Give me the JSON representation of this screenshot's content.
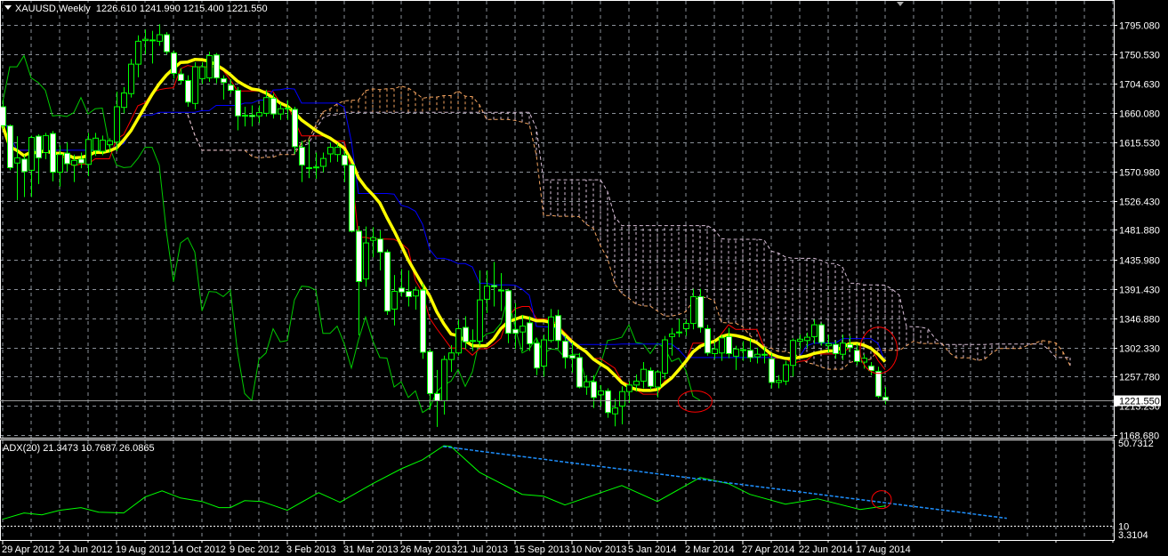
{
  "header": {
    "symbol_timeframe": "XAUUSD,Weekly",
    "open": "1226.610",
    "high": "1241.990",
    "low": "1215.400",
    "close": "1221.550"
  },
  "indicator_header": {
    "name": "ADX(20)",
    "values": "21.3473 10.7687 26.0865"
  },
  "colors": {
    "background": "#000000",
    "grid": "#8a9098",
    "bull_body": "#000000",
    "bear_body": "#ffffff",
    "candle_outline": "#00ff00",
    "ma": "#ffff00",
    "tenkan": "#ff0000",
    "kijun": "#0000ff",
    "chikou": "#00cc00",
    "senkou_a": "#f4a460",
    "senkou_b": "#d8bfd8",
    "adx": "#00ff00",
    "trendline": "#1e90ff",
    "annotation": "#ff0000"
  },
  "chart_data": [
    {
      "type": "candlestick",
      "title": "XAUUSD,Weekly",
      "ylim": [
        1164.6,
        1833.0
      ],
      "price_axis_labels": [
        "1795.080",
        "1750.530",
        "1704.630",
        "1660.080",
        "1615.530",
        "1570.980",
        "1526.430",
        "1481.880",
        "1435.980",
        "1391.430",
        "1346.880",
        "1302.330",
        "1257.780",
        "1213.230",
        "1168.680"
      ],
      "current_price": "1221.550",
      "date_labels": [
        "29 Apr 2012",
        "24 Jun 2012",
        "19 Aug 2012",
        "14 Oct 2012",
        "9 Dec 2012",
        "3 Feb 2013",
        "31 Mar 2013",
        "26 May 2013",
        "21 Jul 2013",
        "15 Sep 2013",
        "10 Nov 2013",
        "5 Jan 2014",
        "2 Mar 2014",
        "27 Apr 2014",
        "22 Jun 2014",
        "17 Aug 2014"
      ],
      "weeks_per_date_label": 8,
      "ohlc": [
        [
          1670,
          1680,
          1636,
          1641
        ],
        [
          1641,
          1643,
          1573,
          1577
        ],
        [
          1584,
          1625,
          1527,
          1592
        ],
        [
          1590,
          1596,
          1532,
          1571
        ],
        [
          1573,
          1626,
          1532,
          1623
        ],
        [
          1625,
          1628,
          1552,
          1592
        ],
        [
          1600,
          1630,
          1590,
          1626
        ],
        [
          1629,
          1633,
          1556,
          1570
        ],
        [
          1570,
          1611,
          1548,
          1597
        ],
        [
          1599,
          1616,
          1571,
          1583
        ],
        [
          1581,
          1597,
          1555,
          1588
        ],
        [
          1590,
          1600,
          1576,
          1584
        ],
        [
          1582,
          1630,
          1564,
          1620
        ],
        [
          1603,
          1630,
          1595,
          1622
        ],
        [
          1602,
          1626,
          1596,
          1619
        ],
        [
          1612,
          1622,
          1600,
          1618
        ],
        [
          1616,
          1693,
          1602,
          1670
        ],
        [
          1669,
          1700,
          1660,
          1691
        ],
        [
          1690,
          1743,
          1684,
          1735
        ],
        [
          1735,
          1779,
          1715,
          1770
        ],
        [
          1771,
          1788,
          1750,
          1773
        ],
        [
          1772,
          1786,
          1736,
          1772
        ],
        [
          1770,
          1796,
          1763,
          1780
        ],
        [
          1780,
          1784,
          1750,
          1754
        ],
        [
          1752,
          1756,
          1713,
          1721
        ],
        [
          1720,
          1729,
          1704,
          1710
        ],
        [
          1710,
          1718,
          1670,
          1677
        ],
        [
          1675,
          1738,
          1666,
          1731
        ],
        [
          1713,
          1738,
          1705,
          1731
        ],
        [
          1714,
          1754,
          1708,
          1748
        ],
        [
          1749,
          1752,
          1706,
          1714
        ],
        [
          1713,
          1718,
          1681,
          1707
        ],
        [
          1703,
          1712,
          1690,
          1695
        ],
        [
          1695,
          1700,
          1634,
          1656
        ],
        [
          1656,
          1670,
          1640,
          1657
        ],
        [
          1657,
          1672,
          1640,
          1655
        ],
        [
          1656,
          1672,
          1645,
          1661
        ],
        [
          1660,
          1696,
          1655,
          1684
        ],
        [
          1683,
          1690,
          1652,
          1659
        ],
        [
          1659,
          1675,
          1650,
          1667
        ],
        [
          1668,
          1680,
          1650,
          1668
        ],
        [
          1666,
          1670,
          1598,
          1609
        ],
        [
          1608,
          1618,
          1555,
          1581
        ],
        [
          1577,
          1620,
          1561,
          1577
        ],
        [
          1577,
          1600,
          1560,
          1578
        ],
        [
          1579,
          1600,
          1570,
          1591
        ],
        [
          1598,
          1615,
          1585,
          1608
        ],
        [
          1597,
          1614,
          1586,
          1608
        ],
        [
          1596,
          1602,
          1555,
          1581
        ],
        [
          1581,
          1583,
          1478,
          1480
        ],
        [
          1480,
          1488,
          1321,
          1403
        ],
        [
          1407,
          1487,
          1395,
          1462
        ],
        [
          1466,
          1486,
          1440,
          1470
        ],
        [
          1468,
          1481,
          1420,
          1448
        ],
        [
          1448,
          1452,
          1352,
          1358
        ],
        [
          1361,
          1413,
          1336,
          1388
        ],
        [
          1393,
          1422,
          1380,
          1387
        ],
        [
          1388,
          1420,
          1365,
          1380
        ],
        [
          1381,
          1395,
          1360,
          1390
        ],
        [
          1390,
          1400,
          1285,
          1295
        ],
        [
          1296,
          1300,
          1208,
          1232
        ],
        [
          1232,
          1268,
          1181,
          1221
        ],
        [
          1221,
          1290,
          1200,
          1284
        ],
        [
          1284,
          1306,
          1265,
          1294
        ],
        [
          1294,
          1345,
          1290,
          1331
        ],
        [
          1333,
          1350,
          1300,
          1311
        ],
        [
          1313,
          1330,
          1297,
          1313
        ],
        [
          1312,
          1420,
          1305,
          1375
        ],
        [
          1376,
          1420,
          1355,
          1396
        ],
        [
          1397,
          1433,
          1365,
          1395
        ],
        [
          1390,
          1416,
          1358,
          1390
        ],
        [
          1389,
          1392,
          1309,
          1324
        ],
        [
          1330,
          1370,
          1300,
          1324
        ],
        [
          1326,
          1352,
          1297,
          1335
        ],
        [
          1340,
          1350,
          1297,
          1308
        ],
        [
          1309,
          1316,
          1260,
          1271
        ],
        [
          1274,
          1322,
          1258,
          1314
        ],
        [
          1313,
          1361,
          1310,
          1349
        ],
        [
          1351,
          1360,
          1300,
          1313
        ],
        [
          1312,
          1320,
          1270,
          1287
        ],
        [
          1290,
          1310,
          1264,
          1286
        ],
        [
          1287,
          1294,
          1240,
          1242
        ],
        [
          1242,
          1260,
          1230,
          1250
        ],
        [
          1250,
          1260,
          1210,
          1226
        ],
        [
          1230,
          1245,
          1212,
          1236
        ],
        [
          1236,
          1240,
          1195,
          1203
        ],
        [
          1201,
          1224,
          1182,
          1210
        ],
        [
          1213,
          1243,
          1185,
          1235
        ],
        [
          1235,
          1251,
          1218,
          1245
        ],
        [
          1245,
          1261,
          1235,
          1251
        ],
        [
          1251,
          1280,
          1240,
          1269
        ],
        [
          1267,
          1272,
          1238,
          1243
        ],
        [
          1242,
          1268,
          1226,
          1265
        ],
        [
          1263,
          1320,
          1254,
          1314
        ],
        [
          1319,
          1332,
          1290,
          1323
        ],
        [
          1326,
          1346,
          1318,
          1326
        ],
        [
          1331,
          1345,
          1320,
          1339
        ],
        [
          1339,
          1392,
          1330,
          1380
        ],
        [
          1380,
          1392,
          1325,
          1333
        ],
        [
          1331,
          1337,
          1290,
          1294
        ],
        [
          1293,
          1312,
          1285,
          1300
        ],
        [
          1294,
          1322,
          1282,
          1317
        ],
        [
          1319,
          1332,
          1286,
          1293
        ],
        [
          1289,
          1305,
          1268,
          1300
        ],
        [
          1299,
          1312,
          1282,
          1299
        ],
        [
          1298,
          1315,
          1280,
          1287
        ],
        [
          1288,
          1302,
          1278,
          1292
        ],
        [
          1292,
          1303,
          1278,
          1292
        ],
        [
          1285,
          1293,
          1240,
          1249
        ],
        [
          1249,
          1260,
          1240,
          1252
        ],
        [
          1251,
          1282,
          1245,
          1276
        ],
        [
          1275,
          1316,
          1258,
          1313
        ],
        [
          1312,
          1322,
          1300,
          1315
        ],
        [
          1313,
          1325,
          1302,
          1318
        ],
        [
          1319,
          1345,
          1308,
          1337
        ],
        [
          1337,
          1340,
          1305,
          1310
        ],
        [
          1305,
          1322,
          1295,
          1308
        ],
        [
          1307,
          1313,
          1285,
          1293
        ],
        [
          1292,
          1322,
          1283,
          1309
        ],
        [
          1307,
          1320,
          1295,
          1302
        ],
        [
          1298,
          1308,
          1275,
          1281
        ],
        [
          1280,
          1292,
          1270,
          1286
        ],
        [
          1274,
          1280,
          1260,
          1267
        ],
        [
          1266,
          1273,
          1225,
          1228
        ],
        [
          1226.61,
          1241.99,
          1215.4,
          1221.55
        ]
      ],
      "indicators": {
        "moving_average_period": 10,
        "ichimoku": {
          "tenkan": 9,
          "kijun": 26,
          "senkou_b": 52,
          "shift": 26
        }
      },
      "annotations": [
        {
          "type": "ellipse",
          "week": 97.3,
          "price": 1220
        },
        {
          "type": "ellipse",
          "week": 123.1,
          "price": 1298
        }
      ]
    },
    {
      "type": "line",
      "title": "ADX(20)",
      "ylim": [
        3.3104,
        50.7312
      ],
      "axis_labels": [
        "50.7312",
        "10",
        "3.3104"
      ],
      "level": 10,
      "adx_points": [
        [
          0,
          13.0
        ],
        [
          3,
          16.1
        ],
        [
          5.5,
          15.2
        ],
        [
          8,
          17.4
        ],
        [
          11,
          18.7
        ],
        [
          13.5,
          16.5
        ],
        [
          17,
          16.1
        ],
        [
          20,
          23.9
        ],
        [
          22.4,
          26.9
        ],
        [
          25,
          23.4
        ],
        [
          28,
          21.7
        ],
        [
          30.4,
          18.7
        ],
        [
          32,
          18.7
        ],
        [
          34,
          22.1
        ],
        [
          36.4,
          21.7
        ],
        [
          40,
          17.4
        ],
        [
          44.4,
          26.0
        ],
        [
          47.4,
          21.3
        ],
        [
          52,
          30.4
        ],
        [
          56,
          37.7
        ],
        [
          59,
          42.1
        ],
        [
          62,
          49.0
        ],
        [
          63,
          48.6
        ],
        [
          67,
          36.0
        ],
        [
          73,
          25.2
        ],
        [
          76,
          24.3
        ],
        [
          79,
          20.0
        ],
        [
          87,
          29.5
        ],
        [
          92,
          21.7
        ],
        [
          98,
          33.4
        ],
        [
          102,
          30.4
        ],
        [
          105,
          25.2
        ],
        [
          110,
          20.4
        ],
        [
          114.5,
          23.0
        ],
        [
          120.5,
          17.8
        ],
        [
          124,
          19.5
        ]
      ],
      "trendline": [
        [
          61.9,
          48.6
        ],
        [
          141.1,
          13.5
        ]
      ],
      "annotations": [
        {
          "type": "ellipse",
          "week": 123.5,
          "value": 22.6
        }
      ]
    }
  ]
}
